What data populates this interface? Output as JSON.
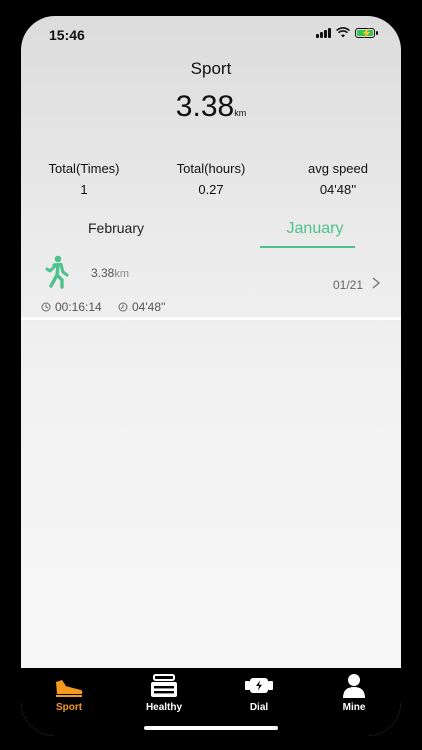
{
  "status": {
    "time": "15:46"
  },
  "header": {
    "title": "Sport",
    "distance": "3.38",
    "distance_unit": "km"
  },
  "stats": [
    {
      "label": "Total(Times)",
      "value": "1"
    },
    {
      "label": "Total(hours)",
      "value": "0.27"
    },
    {
      "label": "avg speed",
      "value": "04'48''"
    }
  ],
  "tabs": {
    "february": "February",
    "january": "January",
    "active": "January"
  },
  "records": [
    {
      "distance": "3.38",
      "unit": "km",
      "date": "01/21",
      "duration": "00:16:14",
      "pace": "04'48''"
    }
  ],
  "tabbar": [
    {
      "label": "Sport",
      "icon": "sport-shoe-icon",
      "active": true
    },
    {
      "label": "Healthy",
      "icon": "healthy-icon"
    },
    {
      "label": "Dial",
      "icon": "dial-watch-icon"
    },
    {
      "label": "Mine",
      "icon": "person-icon"
    }
  ],
  "colors": {
    "accent": "#4ec28c",
    "tab_active": "#f39a1f",
    "battery": "#3ac25a"
  }
}
